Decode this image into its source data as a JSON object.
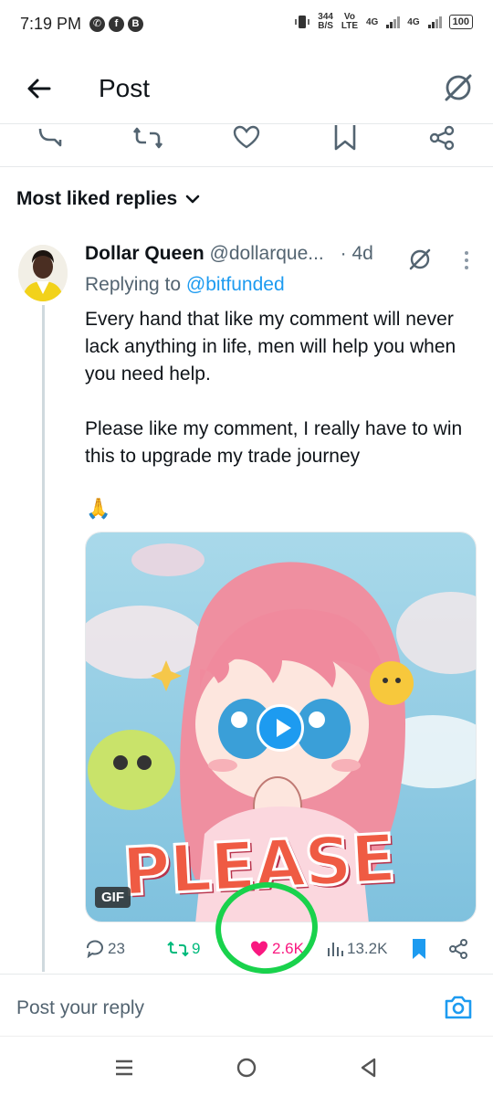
{
  "status_bar": {
    "time": "7:19 PM",
    "net_speed": "344",
    "net_unit": "B/S",
    "volte": "Vo LTE",
    "network1": "4G",
    "network2": "4G",
    "battery": "100"
  },
  "header": {
    "title": "Post",
    "back_icon": "back-arrow-icon",
    "grok_icon": "grok-icon"
  },
  "top_actions": [
    "reply-icon",
    "retweet-icon",
    "like-icon",
    "bookmark-icon",
    "share-icon"
  ],
  "sort": {
    "label": "Most liked replies",
    "icon": "chevron-down-icon"
  },
  "reply": {
    "author_name": "Dollar Queen",
    "author_handle": "@dollarque...",
    "time": "· 4d",
    "replying_to_prefix": "Replying to",
    "replying_to": "@bitfunded",
    "paragraph1": "Every hand that like my comment will never lack anything in life, men will help you when you need help.",
    "paragraph2": "Please like my comment, I really have to win this to upgrade my trade journey",
    "emoji": "🙏",
    "media": {
      "badge": "GIF",
      "overlay_text": "PLEASE"
    }
  },
  "actions": {
    "replies": "23",
    "reposts": "9",
    "likes": "2.6K",
    "views": "13.2K"
  },
  "colors": {
    "accent": "#1d9bf0",
    "like": "#f91880",
    "repost": "#00ba7c",
    "highlight": "#19d24c",
    "muted": "#536471"
  },
  "composer": {
    "placeholder": "Post your reply",
    "camera_icon": "camera-icon"
  },
  "navbar": [
    "menu-icon",
    "home-circle-icon",
    "back-triangle-icon"
  ]
}
